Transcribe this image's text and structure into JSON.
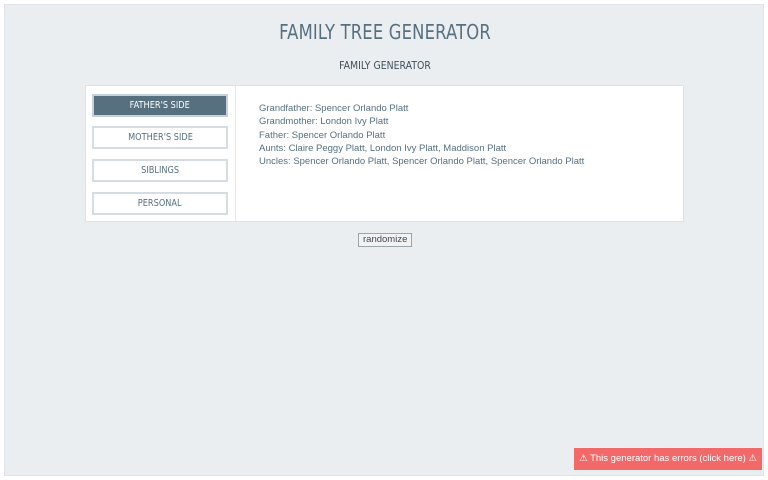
{
  "header": {
    "title": "FAMILY TREE GENERATOR",
    "subtitle": "FAMILY GENERATOR"
  },
  "tabs": [
    {
      "label": "FATHER'S SIDE",
      "active": true
    },
    {
      "label": "MOTHER'S SIDE",
      "active": false
    },
    {
      "label": "SIBLINGS",
      "active": false
    },
    {
      "label": "PERSONAL",
      "active": false
    }
  ],
  "content": {
    "lines": [
      "Grandfather: Spencer Orlando Platt",
      "Grandmother: London Ivy Platt",
      "Father: Spencer Orlando Platt",
      "Aunts: Claire Peggy Platt, London Ivy Platt, Maddison Platt",
      "Uncles: Spencer Orlando Platt, Spencer Orlando Platt, Spencer Orlando Platt"
    ]
  },
  "controls": {
    "randomize_label": "randomize"
  },
  "error": {
    "label": "⚠ This generator has errors (click here) ⚠"
  },
  "colors": {
    "accent": "#56707f",
    "background": "#ebeef1",
    "error": "#f16969"
  }
}
